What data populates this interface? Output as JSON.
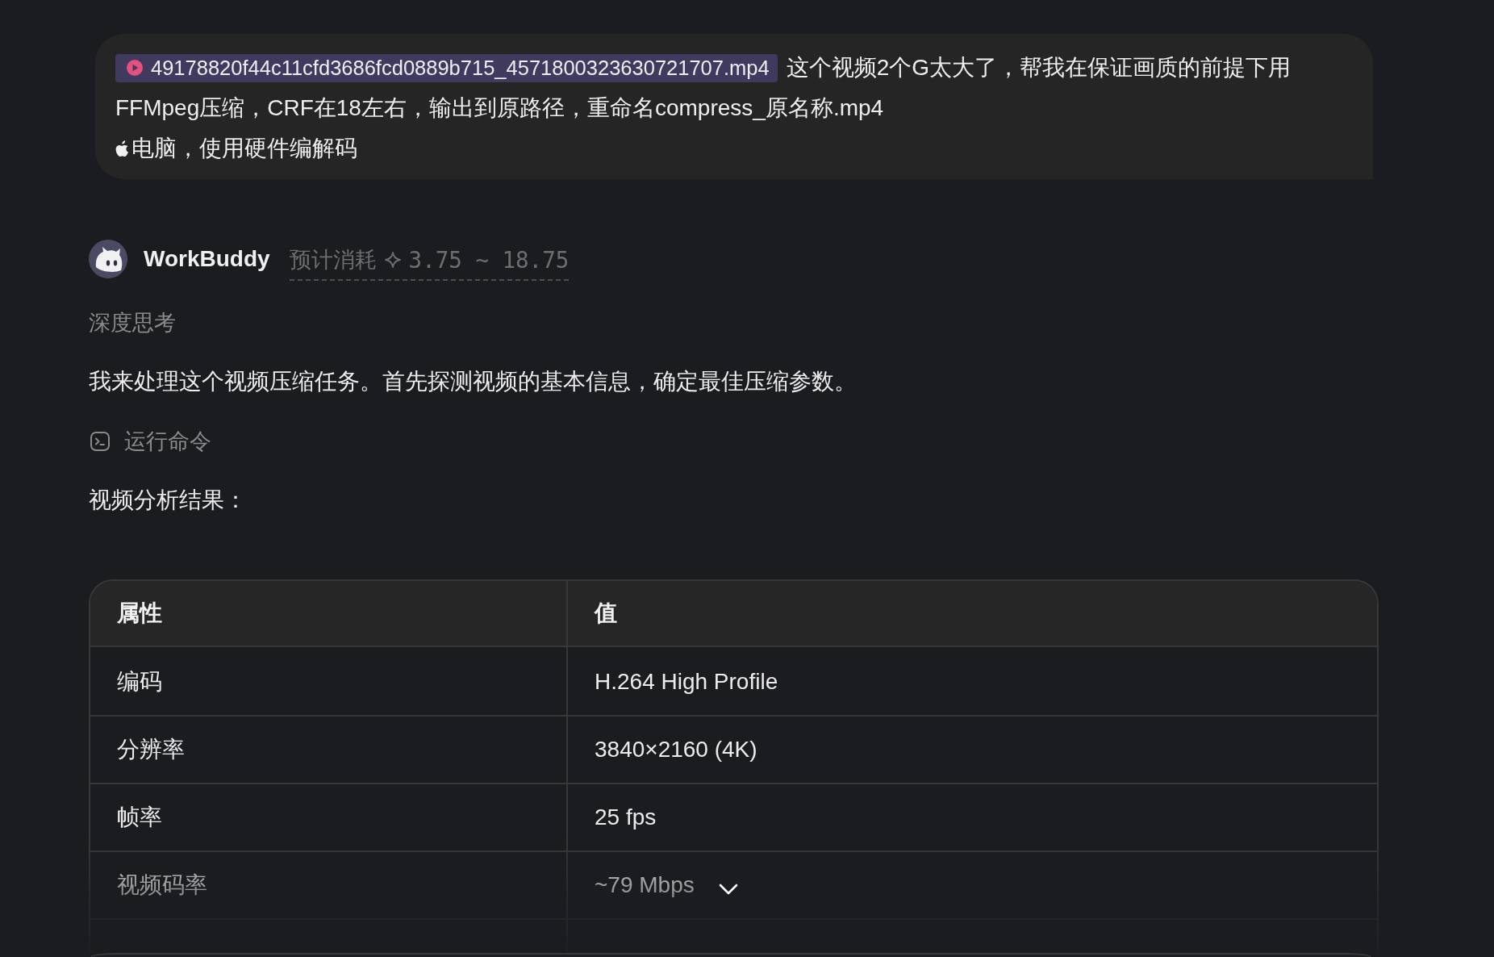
{
  "user_message": {
    "attachment": {
      "filename": "49178820f44c11cfd3686fcd0889b715_4571800323630721707.mp4"
    },
    "first_line": "这个视频2个G太大了，帮我在保证画质的前提下用",
    "lines": [
      {
        "kind": "plain",
        "text": "FFMpeg压缩，CRF在18左右，输出到原路径，重命名compress_原名称.mp4"
      },
      {
        "kind": "logo_prefixed",
        "text": "电脑，使用硬件编解码"
      }
    ]
  },
  "assistant": {
    "name": "WorkBuddy",
    "cost": {
      "label": "预计消耗",
      "range": "3.75 ~ 18.75"
    },
    "thinking_label": "深度思考",
    "intro": "我来处理这个视频压缩任务。首先探测视频的基本信息，确定最佳压缩参数。",
    "tool_call": {
      "label": "运行命令"
    },
    "result_heading": "视频分析结果：",
    "table": {
      "columns": [
        "属性",
        "值"
      ],
      "rows": [
        [
          "编码",
          "H.264 High Profile"
        ],
        [
          "分辨率",
          "3840×2160 (4K)"
        ],
        [
          "帧率",
          "25 fps"
        ],
        [
          "视频码率",
          "~79 Mbps"
        ]
      ]
    }
  }
}
